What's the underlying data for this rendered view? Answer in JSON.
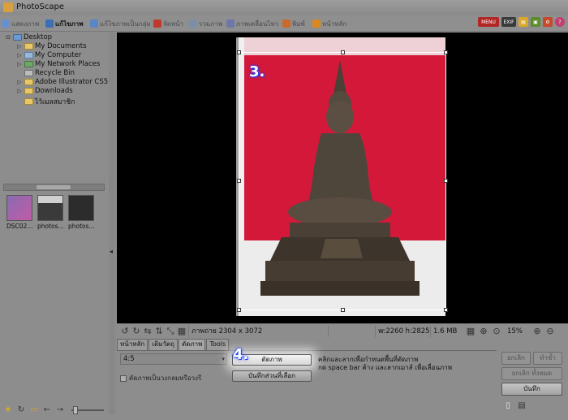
{
  "window": {
    "title": "PhotoScape"
  },
  "tabs": [
    {
      "label": "แสดงภาพ",
      "icon": "viewer-icon",
      "color": "#6a8fcf"
    },
    {
      "label": "แก้ไขภาพ",
      "icon": "editor-icon",
      "color": "#3d6fb6",
      "active": true
    },
    {
      "label": "แก้ไขภาพเป็นกลุ่ม",
      "icon": "batch-editor-icon",
      "color": "#5a86c6"
    },
    {
      "label": "จัดหน้า",
      "icon": "page-icon",
      "color": "#c0392b"
    },
    {
      "label": "รวมภาพ",
      "icon": "combine-icon",
      "color": "#7d8fa6"
    },
    {
      "label": "ภาพเคลื่อนไหว",
      "icon": "animated-gif-icon",
      "color": "#6e78a8"
    },
    {
      "label": "พิมพ์",
      "icon": "print-icon",
      "color": "#c96a2a"
    },
    {
      "label": "หน้าหลัก",
      "icon": "home-icon",
      "color": "#d9891f"
    }
  ],
  "top_buttons": [
    {
      "label": "MENU",
      "color": "#b32626"
    },
    {
      "label": "EXIF",
      "color": "#3a3a3a"
    }
  ],
  "tree": [
    {
      "label": "Desktop",
      "expand": "⊟",
      "indent": 0,
      "type": "desktop"
    },
    {
      "label": "My Documents",
      "expand": "▷",
      "indent": 1,
      "type": "folder"
    },
    {
      "label": "My Computer",
      "expand": "▷",
      "indent": 1,
      "type": "computer"
    },
    {
      "label": "My Network Places",
      "expand": "▷",
      "indent": 1,
      "type": "network"
    },
    {
      "label": "Recycle Bin",
      "expand": "",
      "indent": 1,
      "type": "recycle"
    },
    {
      "label": "Adobe Illustrator CS5",
      "expand": "▷",
      "indent": 1,
      "type": "folder"
    },
    {
      "label": "Downloads",
      "expand": "▷",
      "indent": 1,
      "type": "folder"
    },
    {
      "label": "ไว้เมลสมาชิก",
      "expand": "",
      "indent": 1,
      "type": "folder"
    }
  ],
  "thumbnails": [
    {
      "label": "DSC02...",
      "color": "#8a6ab2"
    },
    {
      "label": "photos...",
      "color": "#3a3a3a"
    },
    {
      "label": "photos...",
      "color": "#2c2c2c"
    }
  ],
  "steps": {
    "crop_step": "3.",
    "button_step": "4."
  },
  "status": {
    "image_info": "ภาพถ่าย 2304 x 3072",
    "selection": "w:2260 h:2825",
    "file_size": "1.6 MB",
    "zoom": "15%"
  },
  "bottom_tabs": [
    {
      "label": "หน้าหลัก"
    },
    {
      "label": "เติมวัตถุ"
    },
    {
      "label": "ตัดภาพ",
      "active": true
    },
    {
      "label": "Tools"
    }
  ],
  "crop_panel": {
    "ratio_value": "4:5",
    "circle_label": "ตัดภาพเป็นวงกลมหรือวงรี",
    "crop_button": "ตัดภาพ",
    "save_selection_button": "บันทึกส่วนที่เลือก",
    "hint_line1": "คลิกและลากเพื่อกำหนดพื้นที่ตัดภาพ",
    "hint_line2": "กด space bar ค้าง และลากเมาส์ เพื่อเลื่อนภาพ"
  },
  "right_buttons": {
    "undo": "ยกเลิก",
    "redo": "ทำซ้ำ",
    "undo_all": "ยกเลิก ทั้งหมด",
    "save": "บันทึก"
  }
}
